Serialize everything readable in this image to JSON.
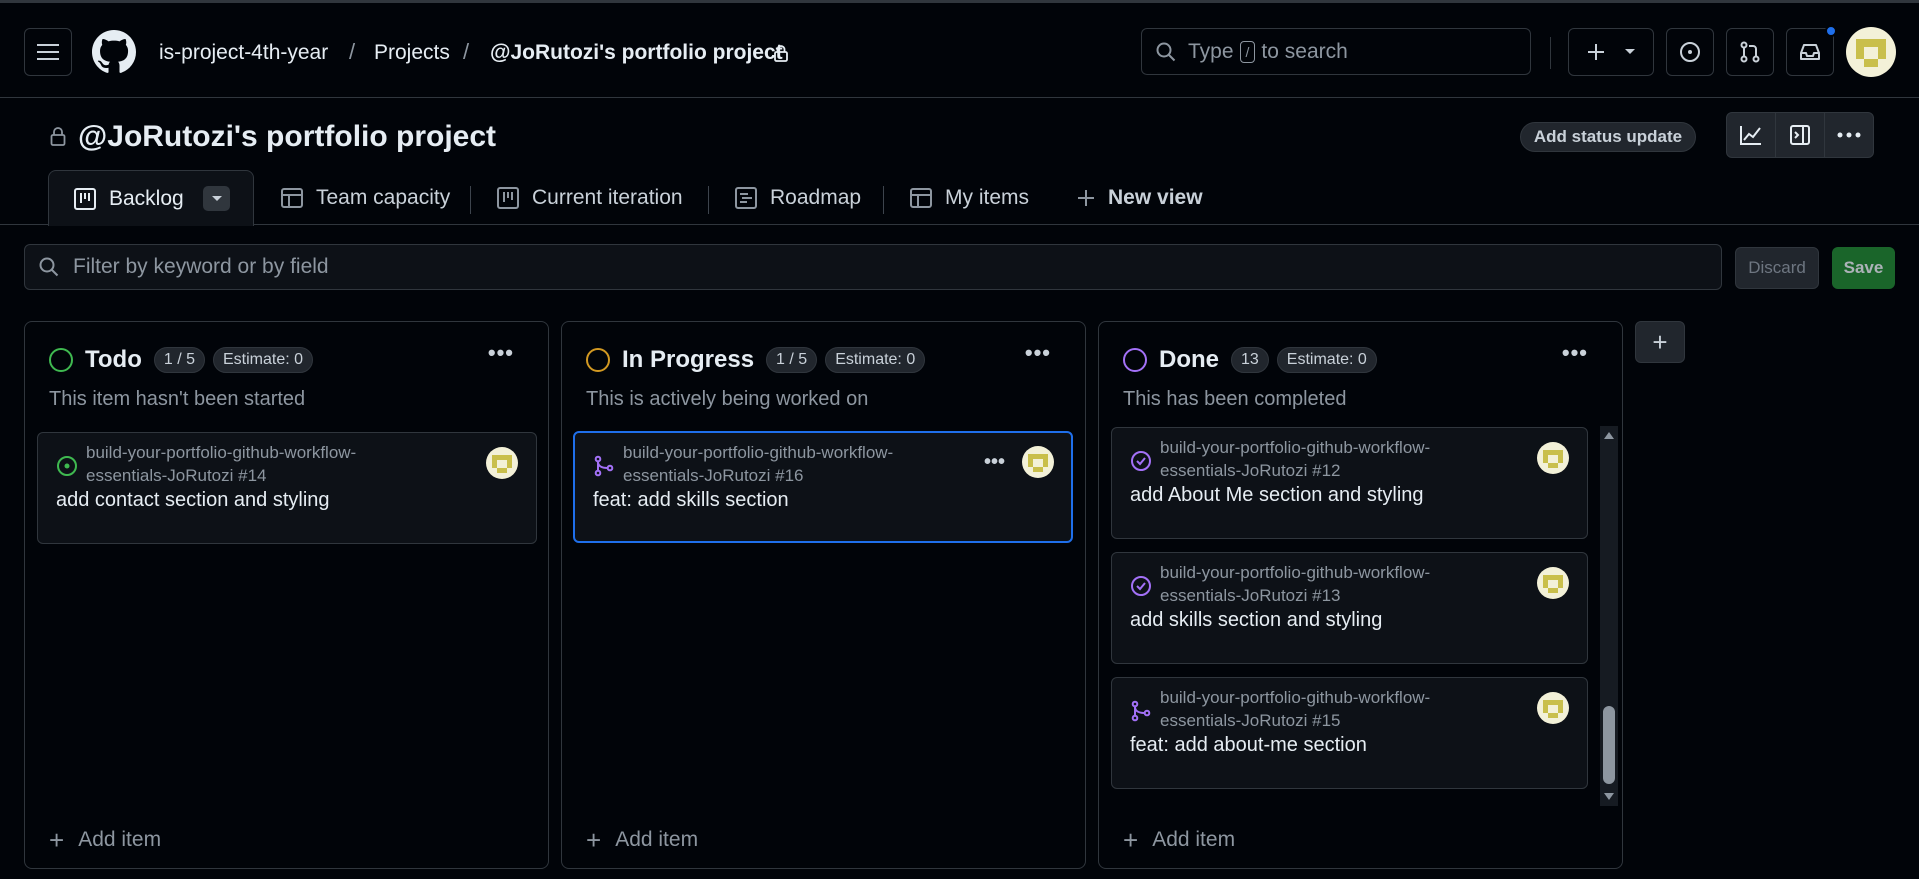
{
  "header": {
    "breadcrumb": [
      "is-project-4th-year",
      "Projects",
      "@JoRutozi's portfolio project"
    ],
    "search": {
      "prefix": "Type",
      "key": "/",
      "suffix": "to search"
    }
  },
  "project": {
    "title": "@JoRutozi's portfolio project",
    "status_update_label": "Add status update"
  },
  "tabs": [
    {
      "label": "Backlog",
      "icon": "board-icon",
      "active": true
    },
    {
      "label": "Team capacity",
      "icon": "table-icon"
    },
    {
      "label": "Current iteration",
      "icon": "board-icon"
    },
    {
      "label": "Roadmap",
      "icon": "roadmap-icon"
    },
    {
      "label": "My items",
      "icon": "table-icon"
    },
    {
      "label": "New view",
      "icon": "plus-icon"
    }
  ],
  "filter": {
    "placeholder": "Filter by keyword or by field",
    "discard_label": "Discard",
    "save_label": "Save"
  },
  "columns": [
    {
      "name": "Todo",
      "count": "1 / 5",
      "estimate": "Estimate: 0",
      "description": "This item hasn't been started",
      "color": "#3fb950",
      "add_label": "Add item",
      "cards": [
        {
          "repo": "build-your-portfolio-github-workflow-essentials-JoRutozi #14",
          "title": "add contact section and styling",
          "icon": "open-issue-icon"
        }
      ]
    },
    {
      "name": "In Progress",
      "count": "1 / 5",
      "estimate": "Estimate: 0",
      "description": "This is actively being worked on",
      "color": "#d29922",
      "add_label": "Add item",
      "cards": [
        {
          "repo": "build-your-portfolio-github-workflow-essentials-JoRutozi #16",
          "title": "feat: add skills section",
          "icon": "merged-pr-icon"
        }
      ]
    },
    {
      "name": "Done",
      "count": "13",
      "estimate": "Estimate: 0",
      "description": "This has been completed",
      "color": "#a371f7",
      "add_label": "Add item",
      "cards": [
        {
          "repo": "build-your-portfolio-github-workflow-essentials-JoRutozi #12",
          "title": "add About Me section and styling",
          "icon": "closed-issue-icon"
        },
        {
          "repo": "build-your-portfolio-github-workflow-essentials-JoRutozi #13",
          "title": "add skills section and styling",
          "icon": "closed-issue-icon"
        },
        {
          "repo": "build-your-portfolio-github-workflow-essentials-JoRutozi #15",
          "title": "feat: add about-me section",
          "icon": "merged-pr-icon"
        }
      ]
    }
  ],
  "colors": {
    "accent": "#1f6feb",
    "save": "#238636",
    "done": "#a371f7",
    "todo": "#3fb950",
    "in_progress": "#d29922"
  }
}
